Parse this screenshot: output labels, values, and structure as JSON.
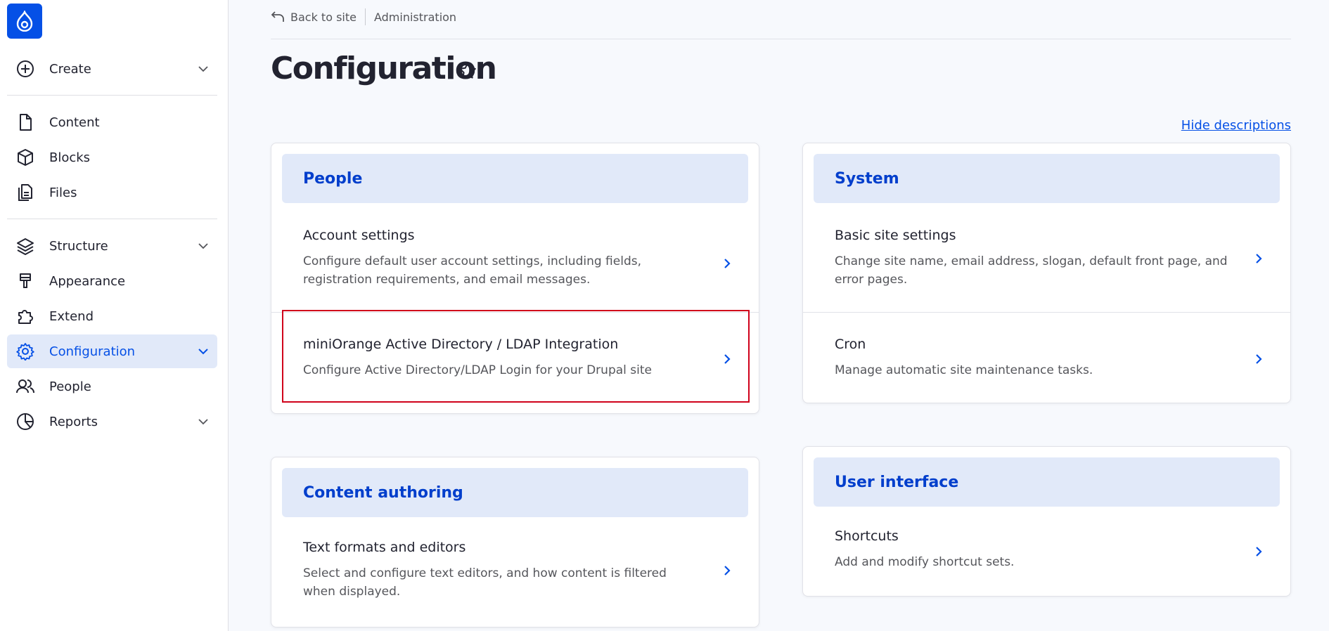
{
  "sidebar": {
    "items": [
      {
        "label": "Create"
      },
      {
        "label": "Content"
      },
      {
        "label": "Blocks"
      },
      {
        "label": "Files"
      },
      {
        "label": "Structure"
      },
      {
        "label": "Appearance"
      },
      {
        "label": "Extend"
      },
      {
        "label": "Configuration"
      },
      {
        "label": "People"
      },
      {
        "label": "Reports"
      }
    ]
  },
  "breadcrumb": {
    "back": "Back to site",
    "current": "Administration"
  },
  "page": {
    "title": "Configuration",
    "hide_descriptions": "Hide descriptions"
  },
  "cards": {
    "people": {
      "heading": "People",
      "items": [
        {
          "title": "Account settings",
          "desc": "Configure default user account settings, including fields, registration requirements, and email messages."
        },
        {
          "title": "miniOrange Active Directory / LDAP Integration",
          "desc": "Configure Active Directory/LDAP Login for your Drupal site"
        }
      ]
    },
    "system": {
      "heading": "System",
      "items": [
        {
          "title": "Basic site settings",
          "desc": "Change site name, email address, slogan, default front page, and error pages."
        },
        {
          "title": "Cron",
          "desc": "Manage automatic site maintenance tasks."
        }
      ]
    },
    "content_authoring": {
      "heading": "Content authoring",
      "items": [
        {
          "title": "Text formats and editors",
          "desc": "Select and configure text editors, and how content is filtered when displayed."
        }
      ]
    },
    "user_interface": {
      "heading": "User interface",
      "items": [
        {
          "title": "Shortcuts",
          "desc": "Add and modify shortcut sets."
        }
      ]
    }
  },
  "colors": {
    "accent": "#0550e6",
    "highlight": "#d0021b",
    "card_head": "#e1e9f9"
  }
}
